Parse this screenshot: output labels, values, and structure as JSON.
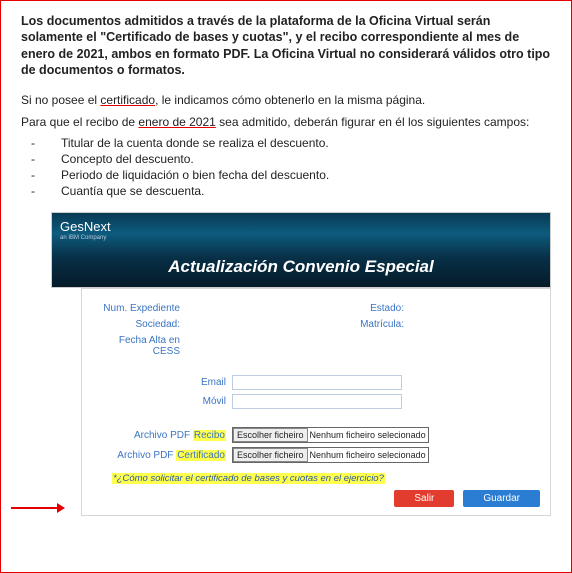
{
  "intro": {
    "bold": "Los documentos admitidos a través de la plataforma de la Oficina Virtual serán solamente el \"Certificado de bases y cuotas\", y el recibo correspondiente al mes de enero de 2021, ambos en formato PDF. La Oficina Virtual no considerará válidos otro tipo de documentos o formatos.",
    "p1a": "Si no posee el ",
    "p1_u": "certificado",
    "p1b": ", le indicamos cómo obtenerlo en la misma página.",
    "p2a": "Para que el recibo de ",
    "p2_u": "enero de 2021",
    "p2b": " sea admitido, deberán figurar en él los siguientes campos:"
  },
  "bullets": [
    "Titular de la cuenta donde se realiza el descuento.",
    "Concepto del descuento.",
    "Periodo de liquidación o bien fecha del descuento.",
    "Cuantía que se descuenta."
  ],
  "app": {
    "brand": "GesNext",
    "brand_sub": "an IBM Company",
    "title": "Actualización Convenio Especial"
  },
  "form": {
    "num_exp": "Num. Expediente",
    "estado": "Estado:",
    "sociedad": "Sociedad:",
    "matricula": "Matrícula:",
    "fecha": "Fecha Alta en CESS",
    "email": "Email",
    "movil": "Móvil",
    "pdf_prefix": "Archivo PDF ",
    "recibo_hl": "Recibo",
    "cert_hl": "Certificado",
    "file_btn": "Escolher ficheiro",
    "file_none": "Nenhum ficheiro selecionado",
    "help": "*¿Cómo solicitar el certificado de bases y cuotas en el ejercicio?",
    "salir": "Salir",
    "guardar": "Guardar"
  }
}
